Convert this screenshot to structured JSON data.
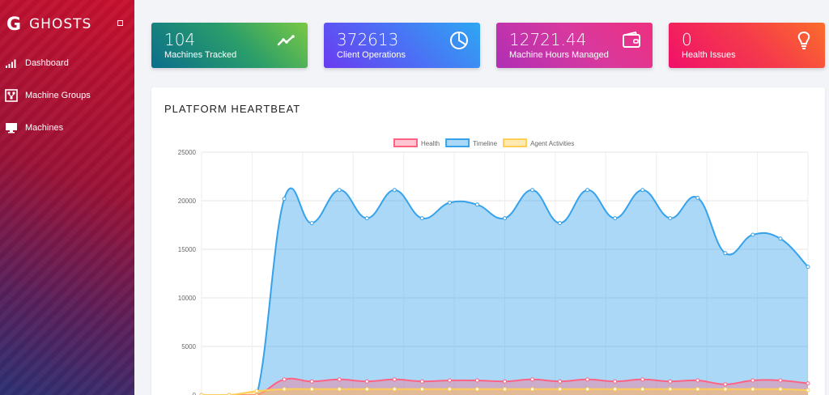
{
  "brand": {
    "logo": "G",
    "name": "GHOSTS"
  },
  "sidebar": {
    "items": [
      {
        "label": "Dashboard",
        "icon": "signal-bars-icon"
      },
      {
        "label": "Machine Groups",
        "icon": "network-icon"
      },
      {
        "label": "Machines",
        "icon": "monitor-icon"
      }
    ]
  },
  "stats": [
    {
      "value": "104",
      "label": "Machines Tracked",
      "icon": "trend-line-icon"
    },
    {
      "value": "372613",
      "label": "Client Operations",
      "icon": "pie-chart-icon"
    },
    {
      "value": "12721.44",
      "label": "Machine Hours Managed",
      "icon": "wallet-icon"
    },
    {
      "value": "0",
      "label": "Health Issues",
      "icon": "lightbulb-icon"
    }
  ],
  "panel": {
    "title": "PLATFORM HEARTBEAT"
  },
  "chart_data": {
    "type": "area",
    "ylim": [
      0,
      25000
    ],
    "y_ticks": [
      "0",
      "5000",
      "10000",
      "15000",
      "20000",
      "25000"
    ],
    "grid": true,
    "legend_position": "top",
    "series": [
      {
        "name": "Health",
        "color": "#ff6384",
        "values": [
          0,
          0,
          0,
          1600,
          1400,
          1600,
          1400,
          1600,
          1400,
          1500,
          1500,
          1400,
          1600,
          1400,
          1600,
          1400,
          1600,
          1400,
          1500,
          1100,
          1500,
          1500,
          1200
        ]
      },
      {
        "name": "Timeline",
        "color": "#36a2eb",
        "values": [
          0,
          0,
          0,
          20200,
          17700,
          21100,
          18200,
          21100,
          18200,
          19800,
          19600,
          18200,
          21100,
          17700,
          21100,
          18200,
          21100,
          18200,
          20300,
          14600,
          16500,
          16100,
          13200
        ]
      },
      {
        "name": "Agent Activities",
        "color": "#ffce56",
        "values": [
          0,
          0,
          400,
          600,
          600,
          600,
          600,
          600,
          600,
          600,
          600,
          600,
          600,
          600,
          600,
          600,
          600,
          600,
          600,
          600,
          600,
          600,
          500
        ]
      }
    ]
  }
}
